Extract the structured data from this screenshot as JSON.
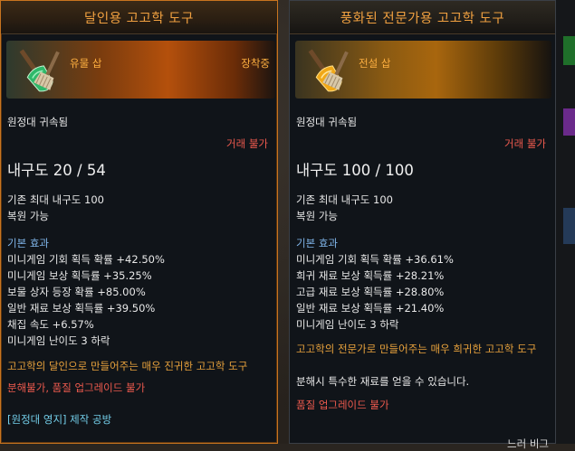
{
  "left": {
    "title": "달인용 고고학 도구",
    "grade": "유물 삽",
    "equipped": "장착중",
    "bound": "원정대 귀속됨",
    "trade": "거래 불가",
    "durability": "내구도 20 / 54",
    "max_durability": "기존 최대 내구도 100",
    "restorable": "복원 가능",
    "effect_header": "기본 효과",
    "effects": [
      "미니게임 기회 획득 확률 +42.50%",
      "미니게임 보상 획득률 +35.25%",
      "보물 상자 등장 확률 +85.00%",
      "일반 재료 보상 획득률 +39.50%",
      "채집 속도 +6.57%",
      "미니게임 난이도 3 하락"
    ],
    "description": "고고학의 달인으로 만들어주는 매우 진귀한 고고학 도구",
    "restrictions": "분해불가, 품질 업그레이드 불가",
    "source": "[원정대 영지] 제작 공방",
    "colors": {
      "border": "#c8741f",
      "title": "#f0a040"
    }
  },
  "right": {
    "title": "풍화된 전문가용 고고학 도구",
    "grade": "전설 삽",
    "bound": "원정대 귀속됨",
    "trade": "거래 불가",
    "durability": "내구도 100 / 100",
    "max_durability": "기존 최대 내구도 100",
    "restorable": "복원 가능",
    "effect_header": "기본 효과",
    "effects": [
      "미니게임 기회 획득 확률 +36.61%",
      "희귀 재료 보상 획득률 +28.21%",
      "고급 재료 보상 획득률 +28.80%",
      "일반 재료 보상 획득률 +21.40%",
      "미니게임 난이도 3 하락"
    ],
    "description": "고고학의 전문가로 만들어주는 매우 희귀한 고고학 도구",
    "dismantle": "분해시 특수한 재료를 얻을 수 있습니다.",
    "restrictions": "품질 업그레이드 불가",
    "partial": "느러 비그",
    "colors": {
      "border": "#3a3f46",
      "title": "#f0a040"
    }
  },
  "icons": {
    "left_item": "green-shovel-icon",
    "right_item": "gold-shovel-icon"
  }
}
